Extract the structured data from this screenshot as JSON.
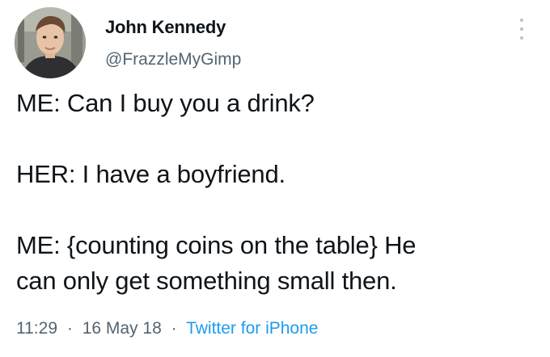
{
  "tweet": {
    "author": {
      "display_name": "John Kennedy",
      "handle": "@FrazzleMyGimp",
      "avatar_icon": "profile-photo"
    },
    "more_icon": "vertical-ellipsis-icon",
    "lines": [
      "ME: Can I buy you a drink?",
      "HER: I have a boyfriend.",
      "ME: {counting coins on the table} He",
      "can only get something small then."
    ],
    "time": "11:29",
    "date": "16 May 18",
    "separator": "·",
    "source": "Twitter for iPhone"
  },
  "colors": {
    "text": "#0f1419",
    "secondary": "#536471",
    "link": "#1d9bf0"
  }
}
